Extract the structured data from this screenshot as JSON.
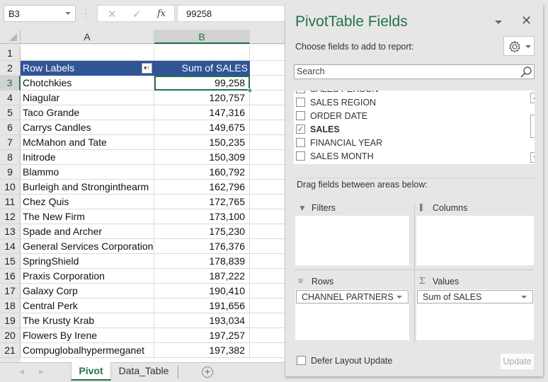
{
  "formula_bar": {
    "name_box": "B3",
    "cancel_icon": "✕",
    "enter_icon": "✓",
    "fx_label": "fx",
    "formula_value": "99258"
  },
  "columns": [
    "A",
    "B"
  ],
  "pivot_table": {
    "header_row_number": "2",
    "row_labels_header": "Row Labels",
    "sum_header": "Sum of SALES",
    "filter_icon": "⍗",
    "rows": [
      {
        "n": "3",
        "label": "Chotchkies",
        "value": "99,258"
      },
      {
        "n": "4",
        "label": "Niagular",
        "value": "120,757"
      },
      {
        "n": "5",
        "label": "Taco Grande",
        "value": "147,316"
      },
      {
        "n": "6",
        "label": "Carrys Candles",
        "value": "149,675"
      },
      {
        "n": "7",
        "label": "McMahon and Tate",
        "value": "150,235"
      },
      {
        "n": "8",
        "label": "Initrode",
        "value": "150,309"
      },
      {
        "n": "9",
        "label": "Blammo",
        "value": "160,792"
      },
      {
        "n": "10",
        "label": "Burleigh and Stronginthearm",
        "value": "162,796"
      },
      {
        "n": "11",
        "label": "Chez Quis",
        "value": "172,765"
      },
      {
        "n": "12",
        "label": "The New Firm",
        "value": "173,100"
      },
      {
        "n": "13",
        "label": "Spade and Archer",
        "value": "175,230"
      },
      {
        "n": "14",
        "label": "General Services Corporation",
        "value": "176,376"
      },
      {
        "n": "15",
        "label": "SpringShield",
        "value": "178,839"
      },
      {
        "n": "16",
        "label": "Praxis Corporation",
        "value": "187,222"
      },
      {
        "n": "17",
        "label": "Galaxy Corp",
        "value": "190,410"
      },
      {
        "n": "18",
        "label": "Central Perk",
        "value": "191,656"
      },
      {
        "n": "19",
        "label": "The Krusty Krab",
        "value": "193,034"
      },
      {
        "n": "20",
        "label": "Flowers By Irene",
        "value": "197,257"
      },
      {
        "n": "21",
        "label": "Compuglobalhypermeganet",
        "value": "197,382"
      }
    ]
  },
  "row1_number": "1",
  "sheet_tabs": {
    "prev_icon": "◀",
    "next_icon": "▶",
    "tabs": [
      "Pivot",
      "Data_Table"
    ],
    "active": "Pivot",
    "add_icon": "+"
  },
  "pivot_pane": {
    "title": "PivotTable Fields",
    "close_icon": "✕",
    "choose_label": "Choose fields to add to report:",
    "search_placeholder": "Search",
    "fields": [
      {
        "label": "SALES PERSON",
        "checked": false
      },
      {
        "label": "SALES REGION",
        "checked": false
      },
      {
        "label": "ORDER DATE",
        "checked": false
      },
      {
        "label": "SALES",
        "checked": true
      },
      {
        "label": "FINANCIAL YEAR",
        "checked": false
      },
      {
        "label": "SALES MONTH",
        "checked": false
      }
    ],
    "check_glyph": "✓",
    "drag_label": "Drag fields between areas below:",
    "areas": {
      "filters": {
        "label": "Filters",
        "icon": "▼",
        "items": []
      },
      "columns": {
        "label": "Columns",
        "icon": "||||",
        "items": []
      },
      "rows": {
        "label": "Rows",
        "icon": "≡",
        "items": [
          "CHANNEL PARTNERS"
        ]
      },
      "values": {
        "label": "Values",
        "icon": "Σ",
        "items": [
          "Sum of SALES"
        ]
      }
    },
    "defer_label": "Defer Layout Update",
    "defer_checked": false,
    "update_label": "Update"
  },
  "colors": {
    "accent_green": "#217346",
    "pivot_header_blue": "#305496"
  }
}
